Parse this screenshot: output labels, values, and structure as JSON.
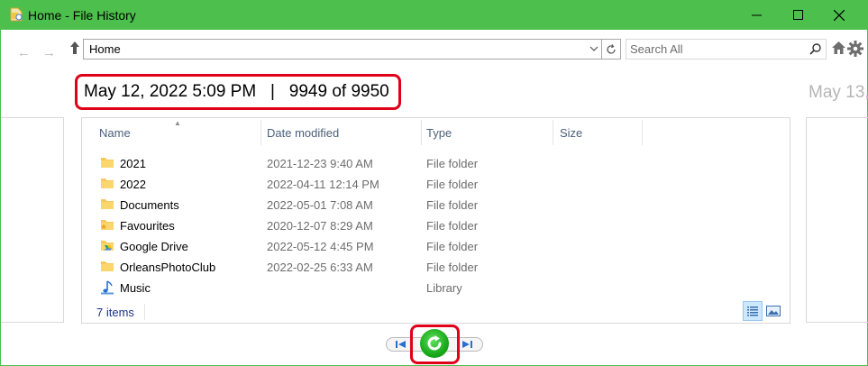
{
  "window": {
    "title": "Home - File History",
    "accent_color": "#4cbf4c",
    "controls": [
      "minimize-icon",
      "maximize-icon",
      "close-icon"
    ]
  },
  "navigation": {
    "back_icon": "arrow-left-icon",
    "forward_icon": "arrow-right-icon",
    "up_icon": "arrow-up-icon",
    "address": "Home",
    "search_placeholder": "Search All"
  },
  "snapshot": {
    "date": "May 12, 2022 5:09 PM",
    "separator": "|",
    "position": "9949 of 9950",
    "next_date": "May 13,",
    "highlight_color": "#e0001a"
  },
  "list": {
    "columns": [
      "Name",
      "Date modified",
      "Type",
      "Size"
    ],
    "rows": [
      {
        "name": "2021",
        "date": "2021-12-23 9:40 AM",
        "type": "File folder",
        "icon": "folder-icon"
      },
      {
        "name": "2022",
        "date": "2022-04-11 12:14 PM",
        "type": "File folder",
        "icon": "folder-icon"
      },
      {
        "name": "Documents",
        "date": "2022-05-01 7:08 AM",
        "type": "File folder",
        "icon": "folder-icon"
      },
      {
        "name": "Favourites",
        "date": "2020-12-07 8:29 AM",
        "type": "File folder",
        "icon": "favourites-folder-icon"
      },
      {
        "name": "Google Drive",
        "date": "2022-05-12 4:45 PM",
        "type": "File folder",
        "icon": "google-drive-folder-icon"
      },
      {
        "name": "OrleansPhotoClub",
        "date": "2022-02-25 6:33 AM",
        "type": "File folder",
        "icon": "folder-icon"
      },
      {
        "name": "Music",
        "date": "",
        "type": "Library",
        "icon": "music-library-icon"
      }
    ],
    "status": "7 items"
  }
}
